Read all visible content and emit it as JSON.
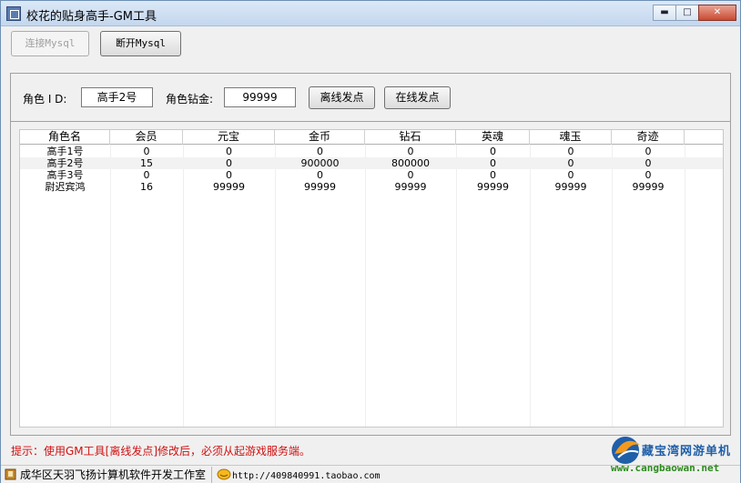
{
  "window": {
    "title": "校花的贴身高手-GM工具",
    "minimize": "▬",
    "maximize": "□",
    "close": "✕"
  },
  "toolbar": {
    "connect_label": "连接Mysql",
    "disconnect_label": "断开Mysql"
  },
  "form": {
    "role_id_label": "角色 I D:",
    "role_id_value": "高手2号",
    "diamond_label": "角色钻金:",
    "diamond_value": "99999",
    "offline_send_label": "离线发点",
    "online_send_label": "在线发点"
  },
  "table": {
    "columns": [
      "角色名",
      "会员",
      "元宝",
      "金币",
      "钻石",
      "英魂",
      "魂玉",
      "奇迹"
    ],
    "rows": [
      [
        "高手1号",
        "0",
        "0",
        "0",
        "0",
        "0",
        "0",
        "0"
      ],
      [
        "高手2号",
        "15",
        "0",
        "900000",
        "800000",
        "0",
        "0",
        "0"
      ],
      [
        "高手3号",
        "0",
        "0",
        "0",
        "0",
        "0",
        "0",
        "0"
      ],
      [
        "尉迟宾鸿",
        "16",
        "99999",
        "99999",
        "99999",
        "99999",
        "99999",
        "99999"
      ]
    ]
  },
  "hint": "提示：使用GM工具[离线发点]修改后，必须从起游戏服务端。",
  "status": {
    "studio": "成华区天羽飞扬计算机软件开发工作室",
    "url": "http://409840991.taobao.com"
  },
  "watermark": {
    "brand": "藏宝湾网游单机",
    "site": "www.cangbaowan.net"
  },
  "colors": {
    "hint": "#d01010",
    "titlebar": "#c4d7ee",
    "watermark_blue": "#1f5fa8",
    "watermark_green": "#2d8a1e"
  },
  "icons": [
    "app-icon",
    "minimize-icon",
    "maximize-icon",
    "close-icon",
    "studio-icon",
    "link-icon",
    "cangbaowan-logo"
  ]
}
